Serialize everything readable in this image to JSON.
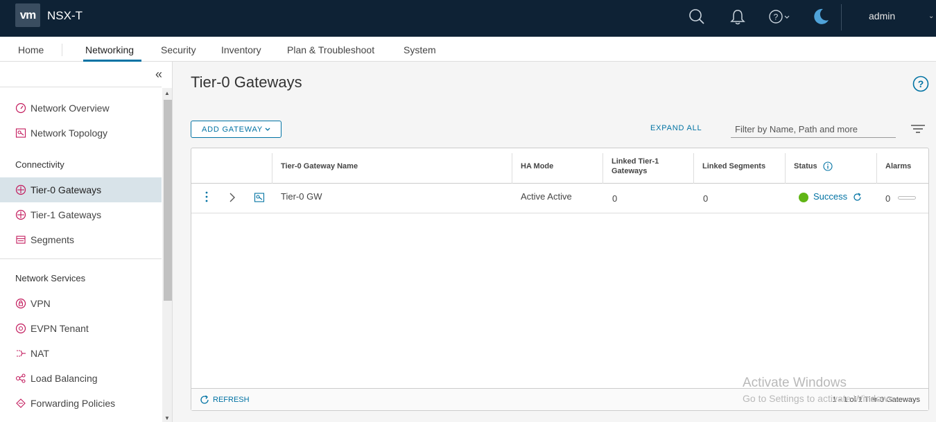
{
  "header": {
    "logo": "vm",
    "app_title": "NSX-T",
    "user": "admin",
    "icons": [
      "search-icon",
      "bell-icon",
      "help-icon",
      "moon-icon"
    ]
  },
  "nav": {
    "tabs": [
      "Home",
      "Networking",
      "Security",
      "Inventory",
      "Plan & Troubleshoot",
      "System"
    ],
    "active": "Networking"
  },
  "sidebar": {
    "top_items": [
      {
        "label": "Network Overview",
        "icon": "gauge-icon"
      },
      {
        "label": "Network Topology",
        "icon": "topology-icon"
      }
    ],
    "sections": [
      {
        "heading": "Connectivity",
        "items": [
          {
            "label": "Tier-0 Gateways",
            "icon": "gateway-icon",
            "active": true
          },
          {
            "label": "Tier-1 Gateways",
            "icon": "gateway-icon"
          },
          {
            "label": "Segments",
            "icon": "segments-icon"
          }
        ]
      },
      {
        "heading": "Network Services",
        "items": [
          {
            "label": "VPN",
            "icon": "vpn-icon"
          },
          {
            "label": "EVPN Tenant",
            "icon": "evpn-icon"
          },
          {
            "label": "NAT",
            "icon": "nat-icon"
          },
          {
            "label": "Load Balancing",
            "icon": "load-balancing-icon"
          },
          {
            "label": "Forwarding Policies",
            "icon": "forwarding-icon"
          }
        ]
      }
    ]
  },
  "main": {
    "title": "Tier-0 Gateways",
    "add_button": "ADD GATEWAY",
    "expand_all": "EXPAND ALL",
    "filter_placeholder": "Filter by Name, Path and more",
    "columns": [
      "Tier-0 Gateway Name",
      "HA Mode",
      "Linked Tier-1 Gateways",
      "Linked Segments",
      "Status",
      "Alarms"
    ],
    "rows": [
      {
        "name": "Tier-0 GW",
        "ha_mode": "Active Active",
        "linked_tier1": "0",
        "linked_segments": "0",
        "status": "Success",
        "alarms": "0"
      }
    ],
    "refresh": "REFRESH",
    "pager": "1 - 1 of 1 Tier-0 Gateways"
  },
  "watermark": {
    "line1": "Activate Windows",
    "line2": "Go to Settings to activate Windows."
  },
  "colors": {
    "header_bg": "#0e2235",
    "accent": "#0072a3",
    "success": "#60b515",
    "sidebar_active": "#d8e3e9",
    "icon_pink": "#c2185b"
  }
}
